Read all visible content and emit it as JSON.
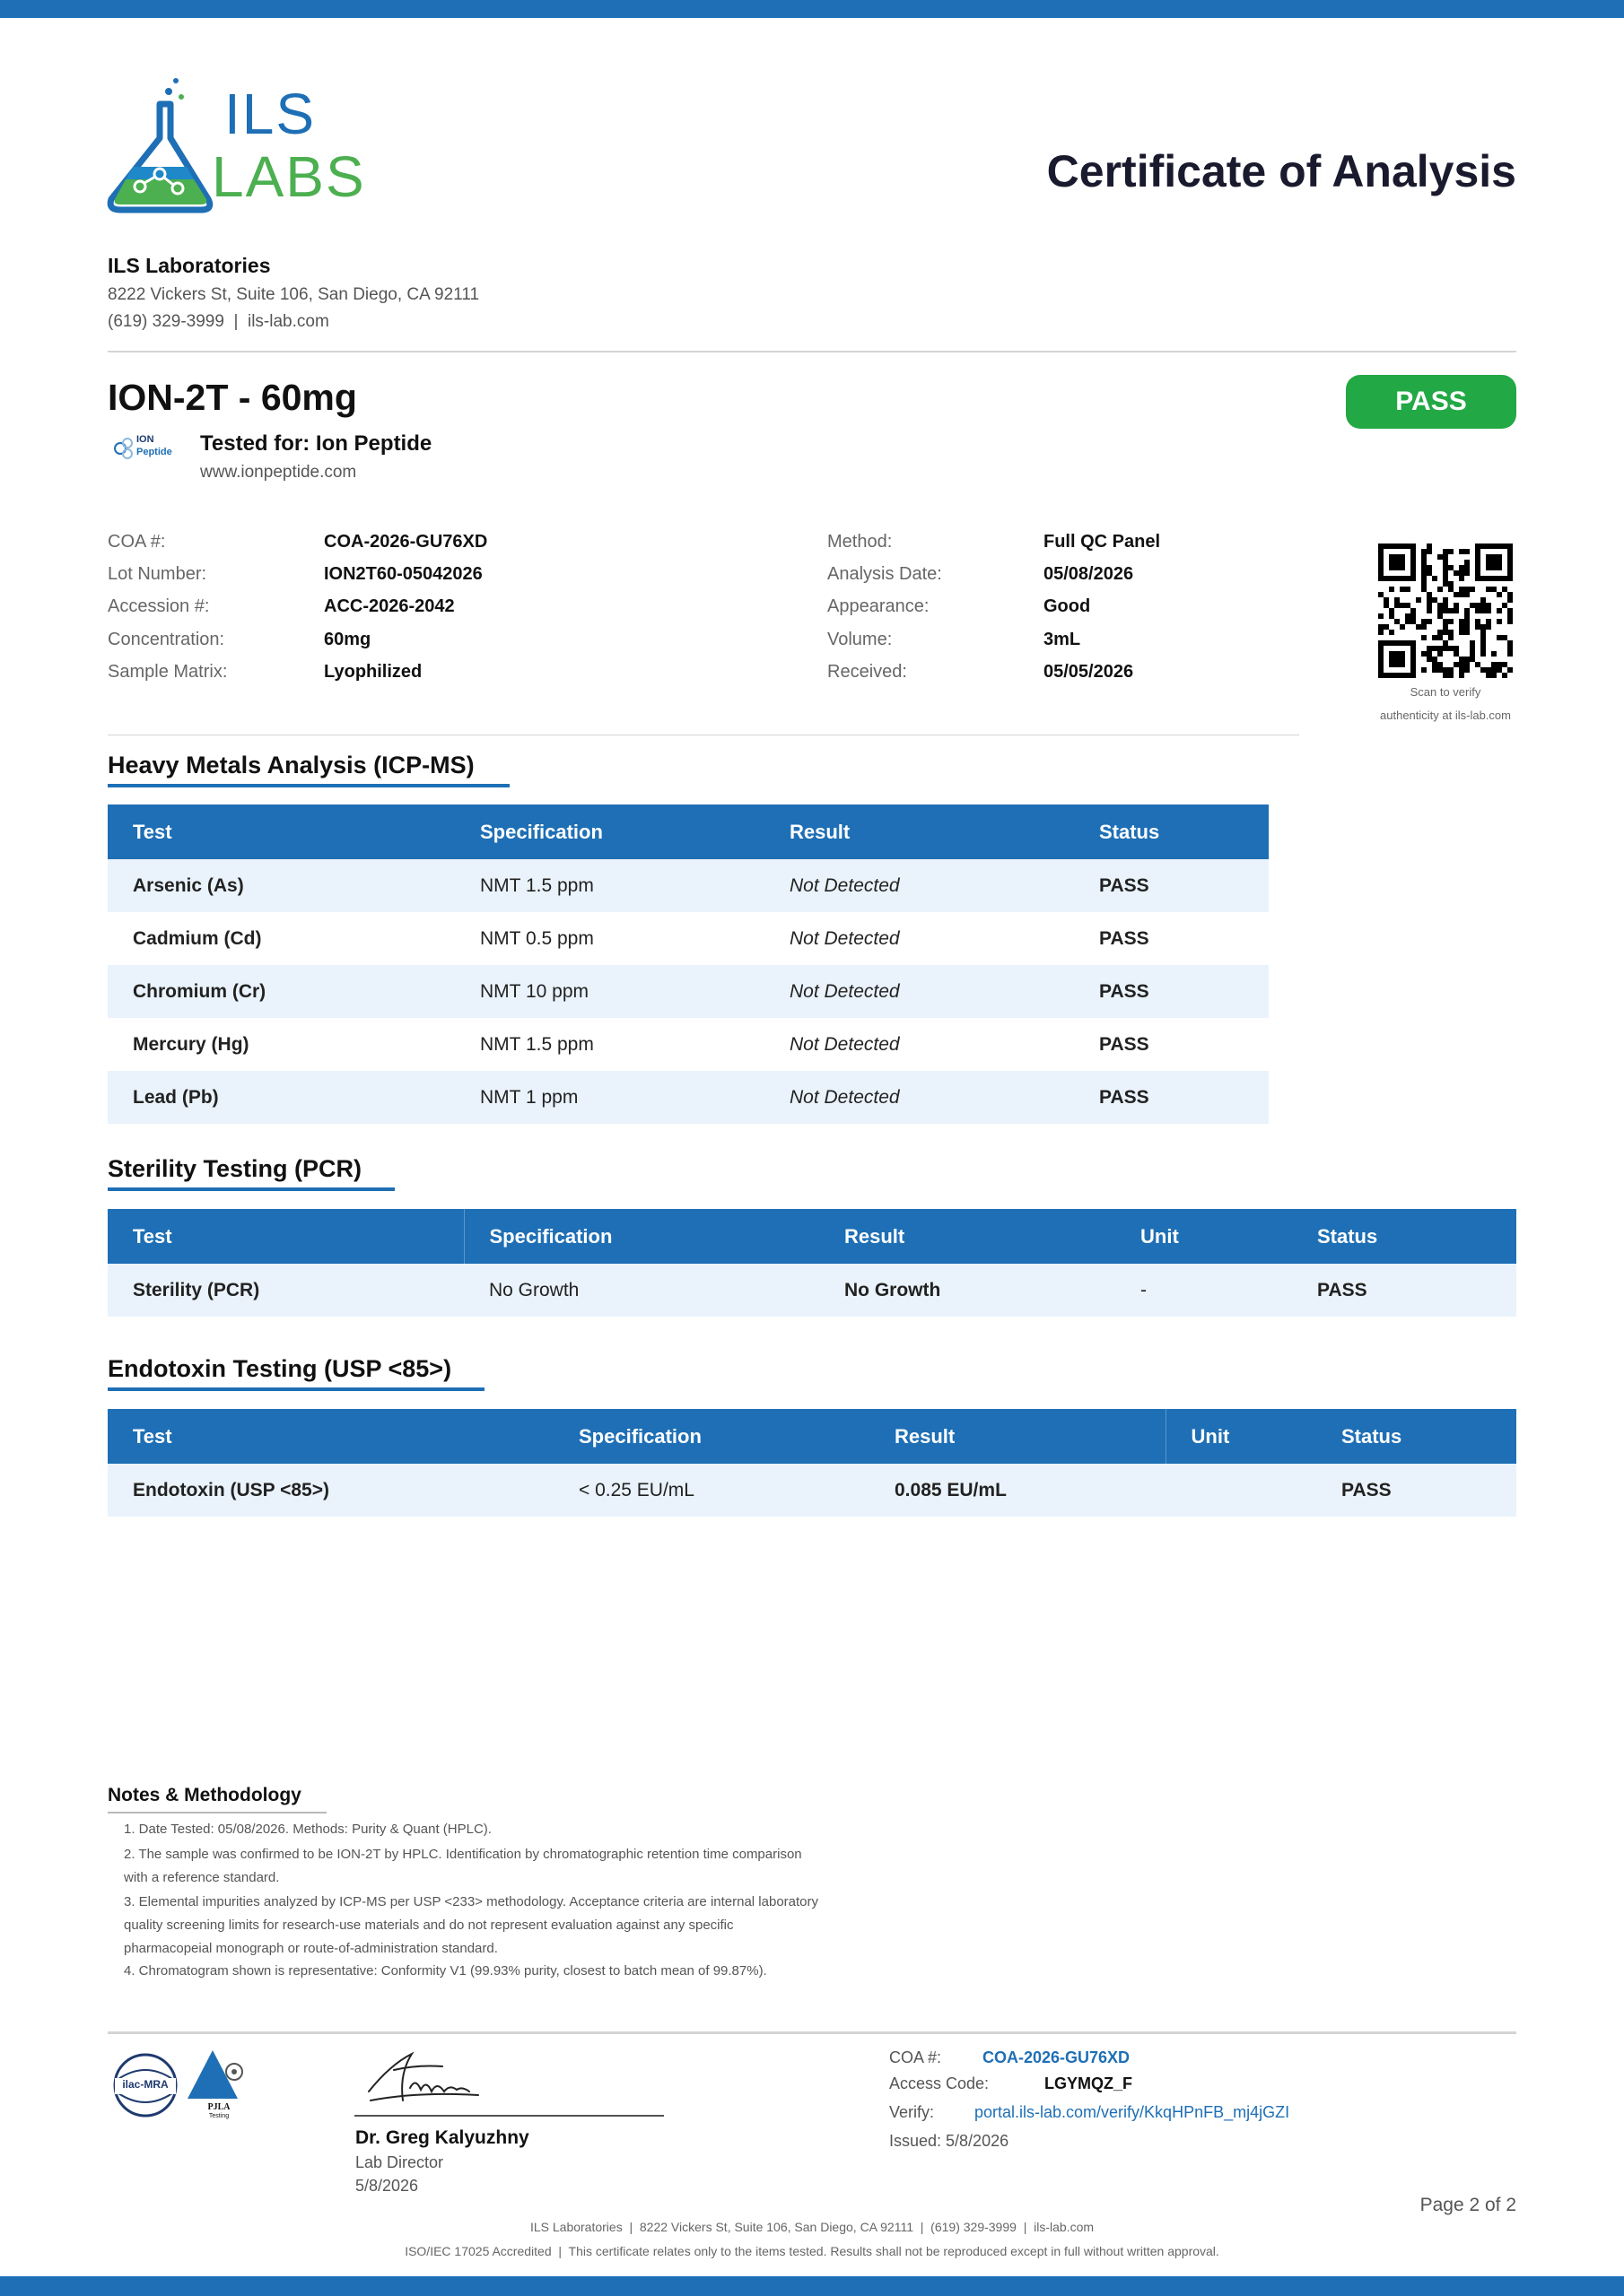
{
  "colors": {
    "brand_blue": "#1e6fb5",
    "pass_green": "#22a844",
    "row_tint": "#eaf3fb",
    "logo_green": "#4caf50"
  },
  "header": {
    "logo_word1": "ILS",
    "logo_word2": "LABS",
    "doc_title": "Certificate of Analysis",
    "lab_name": "ILS Laboratories",
    "lab_address": "8222 Vickers St, Suite 106, San Diego, CA 92111",
    "lab_contact": "(619) 329-3999  |  ils-lab.com"
  },
  "product": {
    "name": "ION-2T - 60mg",
    "overall_status": "PASS",
    "client_logo_line1": "ION",
    "client_logo_line2": "Peptide",
    "tested_for": "Tested for: Ion Peptide",
    "client_url": "www.ionpeptide.com"
  },
  "meta": {
    "left": [
      {
        "label": "COA #:",
        "value": "COA-2026-GU76XD"
      },
      {
        "label": "Lot Number:",
        "value": "ION2T60-05042026"
      },
      {
        "label": "Accession #:",
        "value": "ACC-2026-2042"
      },
      {
        "label": "Concentration:",
        "value": "60mg"
      },
      {
        "label": "Sample Matrix:",
        "value": "Lyophilized"
      }
    ],
    "right": [
      {
        "label": "Method:",
        "value": "Full QC Panel"
      },
      {
        "label": "Analysis Date:",
        "value": "05/08/2026"
      },
      {
        "label": "Appearance:",
        "value": "Good"
      },
      {
        "label": "Volume:",
        "value": "3mL"
      },
      {
        "label": "Received:",
        "value": "05/05/2026"
      }
    ],
    "qr_caption_1": "Scan to verify",
    "qr_caption_2": "authenticity at ils-lab.com"
  },
  "heavy_metals": {
    "title": "Heavy Metals Analysis (ICP-MS)",
    "headers": [
      "Test",
      "Specification",
      "Result",
      "Status"
    ],
    "rows": [
      [
        "Arsenic (As)",
        "NMT 1.5 ppm",
        "Not Detected",
        "PASS"
      ],
      [
        "Cadmium (Cd)",
        "NMT 0.5 ppm",
        "Not Detected",
        "PASS"
      ],
      [
        "Chromium (Cr)",
        "NMT 10 ppm",
        "Not Detected",
        "PASS"
      ],
      [
        "Mercury (Hg)",
        "NMT 1.5 ppm",
        "Not Detected",
        "PASS"
      ],
      [
        "Lead (Pb)",
        "NMT 1 ppm",
        "Not Detected",
        "PASS"
      ]
    ]
  },
  "sterility": {
    "title": "Sterility Testing (PCR)",
    "headers": [
      "Test",
      "Specification",
      "Result",
      "Unit",
      "Status"
    ],
    "rows": [
      [
        "Sterility (PCR)",
        "No Growth",
        "No Growth",
        "-",
        "PASS"
      ]
    ]
  },
  "endotoxin": {
    "title": "Endotoxin Testing (USP <85>)",
    "headers": [
      "Test",
      "Specification",
      "Result",
      "Unit",
      "Status"
    ],
    "rows": [
      [
        "Endotoxin (USP <85>)",
        "< 0.25 EU/mL",
        "0.085 EU/mL",
        "",
        "PASS"
      ]
    ]
  },
  "notes": {
    "title": "Notes & Methodology",
    "items": [
      [
        "1. Date Tested: 05/08/2026. Methods: Purity & Quant (HPLC)."
      ],
      [
        "2. The sample was confirmed to be ION-2T by HPLC. Identification by chromatographic retention time comparison",
        "with a reference standard."
      ],
      [
        "3. Elemental impurities analyzed by ICP-MS per USP <233> methodology. Acceptance criteria are internal laboratory",
        "quality screening limits for research-use materials and do not represent evaluation against any specific",
        "pharmacopeial monograph or route-of-administration standard."
      ],
      [
        "4. Chromatogram shown is representative: Conformity V1 (99.93% purity, closest to batch mean of 99.87%)."
      ]
    ]
  },
  "footer": {
    "accreditation_1": "ilac-MRA",
    "accreditation_2": "PJLA",
    "accreditation_2_sub": "Testing",
    "signer_name": "Dr. Greg Kalyuzhny",
    "signer_role": "Lab Director",
    "signer_date": "5/8/2026",
    "coa_label": "COA #:",
    "coa_value": "COA-2026-GU76XD",
    "access_label": "Access Code:",
    "access_value": "LGYMQZ_F",
    "verify_label": "Verify:",
    "verify_value": "portal.ils-lab.com/verify/KkqHPnFB_mj4jGZI",
    "issued": "Issued: 5/8/2026",
    "page": "Page 2 of 2",
    "fine_1": "ILS Laboratories  |  8222 Vickers St, Suite 106, San Diego, CA 92111  |  (619) 329-3999  |  ils-lab.com",
    "fine_2": "ISO/IEC 17025 Accredited  |  This certificate relates only to the items tested. Results shall not be reproduced except in full without written approval."
  }
}
